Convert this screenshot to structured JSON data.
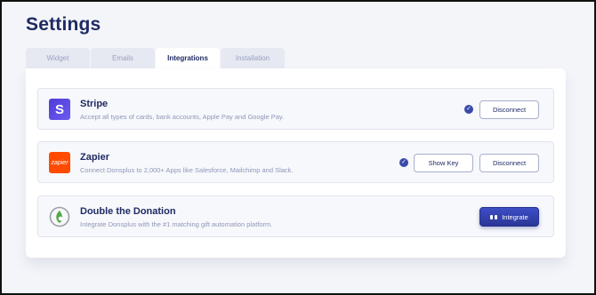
{
  "page": {
    "title": "Settings"
  },
  "tabs": [
    {
      "label": "Widget",
      "active": false
    },
    {
      "label": "Emails",
      "active": false
    },
    {
      "label": "Integrations",
      "active": true
    },
    {
      "label": "Installation",
      "active": false
    }
  ],
  "integrations": [
    {
      "name": "Stripe",
      "logo_text": "S",
      "description": "Accept all types of cards, bank accounts, Apple Pay and Google Pay.",
      "connected": true,
      "buttons": {
        "disconnect": "Disconnect"
      }
    },
    {
      "name": "Zapier",
      "logo_text": "zapier",
      "description": "Connect Donsplus to 2,000+ Apps like Salesforce, Mailchimp and Slack.",
      "connected": true,
      "buttons": {
        "show_key": "Show Key",
        "disconnect": "Disconnect"
      }
    },
    {
      "name": "Double the Donation",
      "description": "Integrate Donsplus with the #1 matching gift automation platform.",
      "connected": false,
      "buttons": {
        "integrate": "Integrate"
      }
    }
  ],
  "colors": {
    "heading": "#1f2a63",
    "accent": "#3b4aa8",
    "stripe_brand": "#5b4be6",
    "zapier_brand": "#ff4a00",
    "dtd_brand": "#55a84a"
  },
  "icons": {
    "connected": "check-circle-icon",
    "integrate": "plug-icon"
  }
}
